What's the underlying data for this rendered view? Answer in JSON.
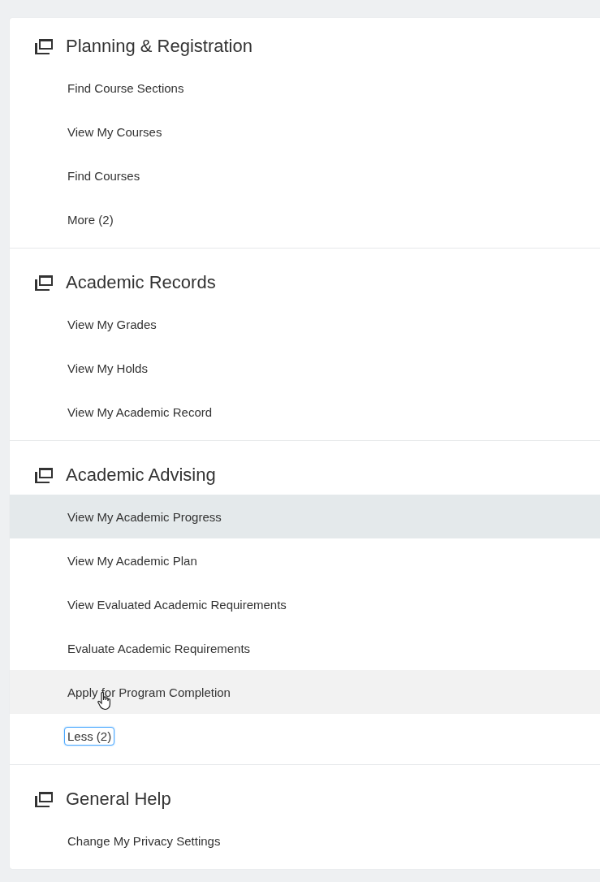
{
  "sections": [
    {
      "title": "Planning & Registration",
      "items": [
        {
          "label": "Find Course Sections",
          "selected": false,
          "hovered": false
        },
        {
          "label": "View My Courses",
          "selected": false,
          "hovered": false
        },
        {
          "label": "Find Courses",
          "selected": false,
          "hovered": false
        }
      ],
      "toggle": {
        "label": "More (2)",
        "focused": false
      }
    },
    {
      "title": "Academic Records",
      "items": [
        {
          "label": "View My Grades",
          "selected": false,
          "hovered": false
        },
        {
          "label": "View My Holds",
          "selected": false,
          "hovered": false
        },
        {
          "label": "View My Academic Record",
          "selected": false,
          "hovered": false
        }
      ]
    },
    {
      "title": "Academic Advising",
      "items": [
        {
          "label": "View My Academic Progress",
          "selected": true,
          "hovered": false
        },
        {
          "label": "View My Academic Plan",
          "selected": false,
          "hovered": false
        },
        {
          "label": "View Evaluated Academic Requirements",
          "selected": false,
          "hovered": false
        },
        {
          "label": "Evaluate Academic Requirements",
          "selected": false,
          "hovered": false
        },
        {
          "label": "Apply for Program Completion",
          "selected": false,
          "hovered": true
        }
      ],
      "toggle": {
        "label": "Less (2)",
        "focused": true
      }
    },
    {
      "title": "General Help",
      "items": [
        {
          "label": "Change My Privacy Settings",
          "selected": false,
          "hovered": false
        }
      ]
    }
  ]
}
